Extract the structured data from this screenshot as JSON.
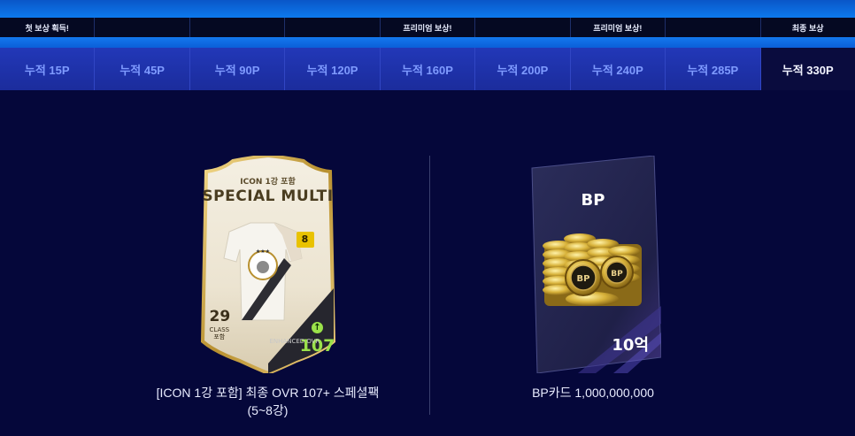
{
  "badges": [
    "첫 보상 획득!",
    "",
    "",
    "",
    "프리미엄 보상!",
    "",
    "프리미엄 보상!",
    "",
    "최종 보상"
  ],
  "tabs": [
    {
      "label": "누적 15P",
      "active": false
    },
    {
      "label": "누적 45P",
      "active": false
    },
    {
      "label": "누적 90P",
      "active": false
    },
    {
      "label": "누적 120P",
      "active": false
    },
    {
      "label": "누적 160P",
      "active": false
    },
    {
      "label": "누적 200P",
      "active": false
    },
    {
      "label": "누적 240P",
      "active": false
    },
    {
      "label": "누적 285P",
      "active": false
    },
    {
      "label": "누적 330P",
      "active": true
    }
  ],
  "reward_left": {
    "card": {
      "icon_label": "ICON 1강 포함",
      "title": "SPECIAL MULTI",
      "shirt_number": "8",
      "class_value": "29",
      "class_label": "CLASS",
      "class_sub": "포함",
      "ovr_value": "107",
      "ovr_label": "ENHANCED OVR"
    },
    "caption_line1": "[ICON 1강 포함] 최종 OVR 107+ 스페셜팩",
    "caption_line2": "(5~8강)"
  },
  "reward_right": {
    "card": {
      "label": "BP",
      "amount": "10억"
    },
    "caption": "BP카드 1,000,000,000"
  },
  "colors": {
    "background": "#05073a",
    "tab_bg": "#1e2fa8",
    "tab_active_bg": "#0a0c3e",
    "tab_text": "#7f9bff",
    "badge_bg": "#050922",
    "ovr_green": "#9be24a",
    "gold": "#c9a54a"
  }
}
